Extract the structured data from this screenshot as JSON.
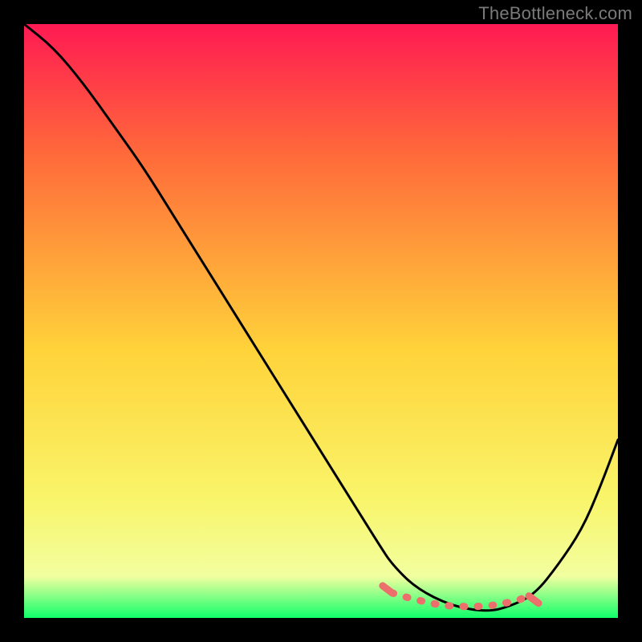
{
  "watermark": "TheBottleneck.com",
  "colors": {
    "background": "#000000",
    "watermark_text": "#7a7a7a",
    "curve": "#000000",
    "tolerance_zone": "#ec6f6b",
    "gradient_top": "#ff1a53",
    "gradient_mid_upper": "#ff6a3a",
    "gradient_mid": "#ffd33a",
    "gradient_lower": "#f9f56a",
    "gradient_near_bottom": "#f2ffa0",
    "gradient_bottom": "#10ff6a"
  },
  "chart_data": {
    "type": "line",
    "title": "",
    "xlabel": "",
    "ylabel": "",
    "xlim": [
      0,
      100
    ],
    "ylim": [
      0,
      100
    ],
    "grid": false,
    "series": [
      {
        "name": "bottleneck-curve",
        "x": [
          0,
          5,
          10,
          15,
          20,
          25,
          30,
          35,
          40,
          45,
          50,
          55,
          60,
          62,
          66,
          72,
          78,
          82,
          86,
          90,
          94,
          97,
          100
        ],
        "values": [
          100,
          96,
          90,
          83,
          76,
          68,
          60,
          52,
          44,
          36,
          28,
          20,
          12,
          9,
          5,
          2,
          1,
          2,
          4,
          9,
          15,
          22,
          30
        ]
      }
    ],
    "tolerance_zone": {
      "name": "tolerance-dots",
      "x": [
        62,
        65,
        68,
        70,
        72,
        75,
        78,
        80,
        83,
        85
      ],
      "values": [
        4.2,
        3.3,
        2.6,
        2.2,
        2.0,
        1.9,
        2.0,
        2.3,
        2.9,
        3.7
      ]
    }
  }
}
